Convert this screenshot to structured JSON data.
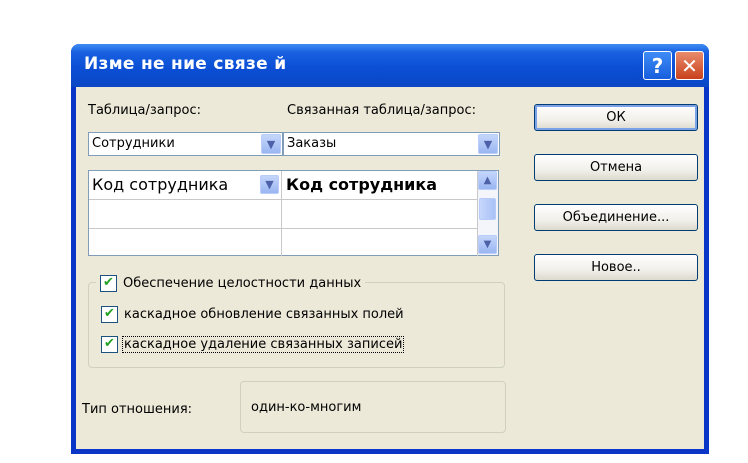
{
  "window": {
    "title": "Изме не ние связе й",
    "help_icon": "?",
    "close_icon": "✕"
  },
  "table_label": "Таблица/запрос:",
  "related_label": "Связанная таблица/запрос:",
  "table_combo": {
    "value": "Сотрудники"
  },
  "related_combo": {
    "value": "Заказы"
  },
  "fields_grid": {
    "rows": [
      {
        "left": "Код сотрудника",
        "right": "Код сотрудника"
      },
      {
        "left": "",
        "right": ""
      },
      {
        "left": "",
        "right": ""
      }
    ]
  },
  "buttons": {
    "ok": "ОК",
    "cancel": "Отмена",
    "join": "Объединение...",
    "new": "Новое.."
  },
  "integrity": {
    "label": "Обеспечение целостности данных",
    "checked": true,
    "cascade_update": {
      "label": "каскадное обновление связанных полей",
      "checked": true
    },
    "cascade_delete": {
      "label": "каскадное удаление связанных записей",
      "checked": true
    }
  },
  "relationship": {
    "label": "Тип отношения:",
    "value": "один-ко-многим"
  },
  "colors": {
    "titlebar": "#0a47c4",
    "dialog_bg": "#ece9d8",
    "check": "#21a121"
  }
}
